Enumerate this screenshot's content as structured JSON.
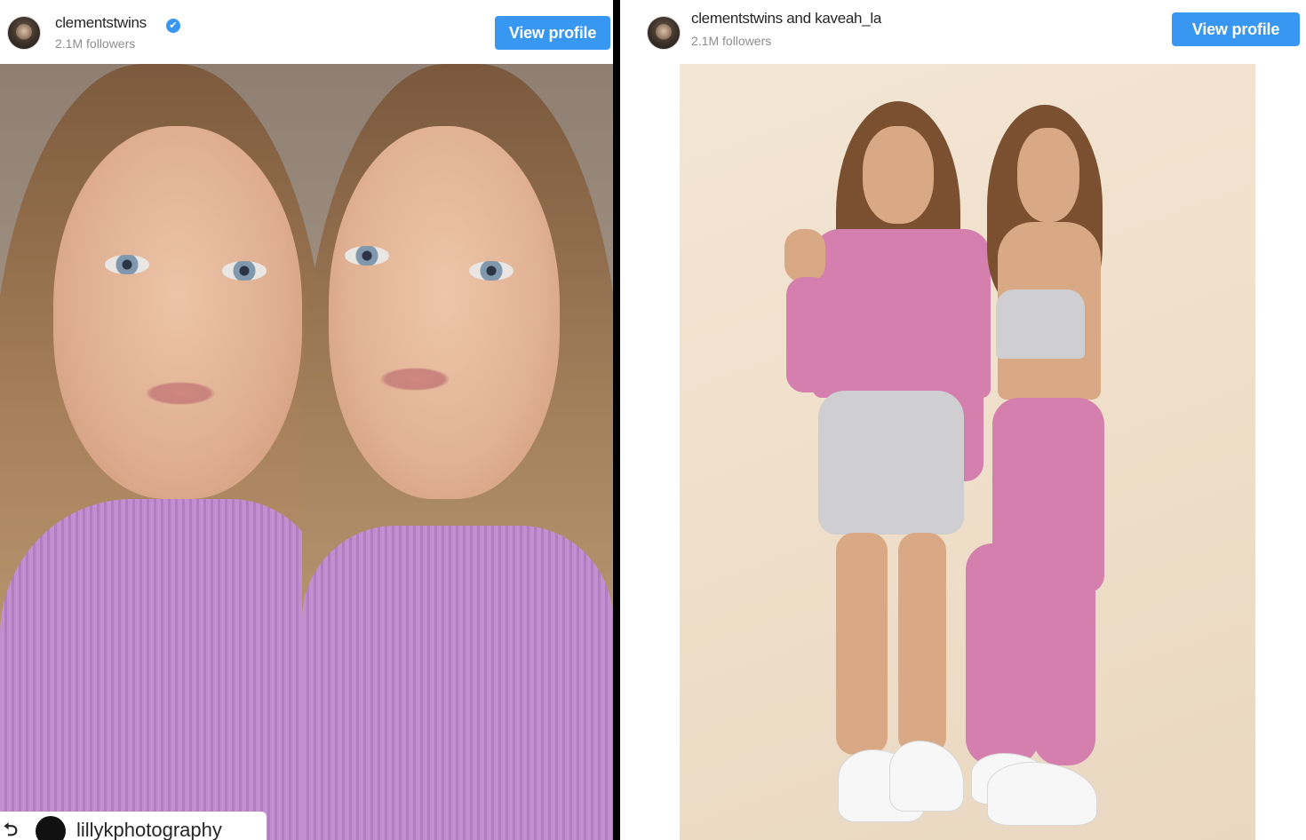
{
  "left_post": {
    "username": "clementstwins",
    "verified_badge": "✔",
    "followers": "2.1M followers",
    "view_profile_label": "View profile",
    "repost_icon": "⮌",
    "repost_username": "lillykphotography"
  },
  "right_post": {
    "username": "clementstwins and kaveah_la",
    "followers": "2.1M followers",
    "view_profile_label": "View profile"
  },
  "colors": {
    "button_blue": "#3897f0",
    "divider": "#000000",
    "username_text": "#262626",
    "followers_text": "#8e8e8e"
  },
  "icons": [
    "avatar-icon",
    "verified-badge-icon",
    "repost-icon"
  ]
}
